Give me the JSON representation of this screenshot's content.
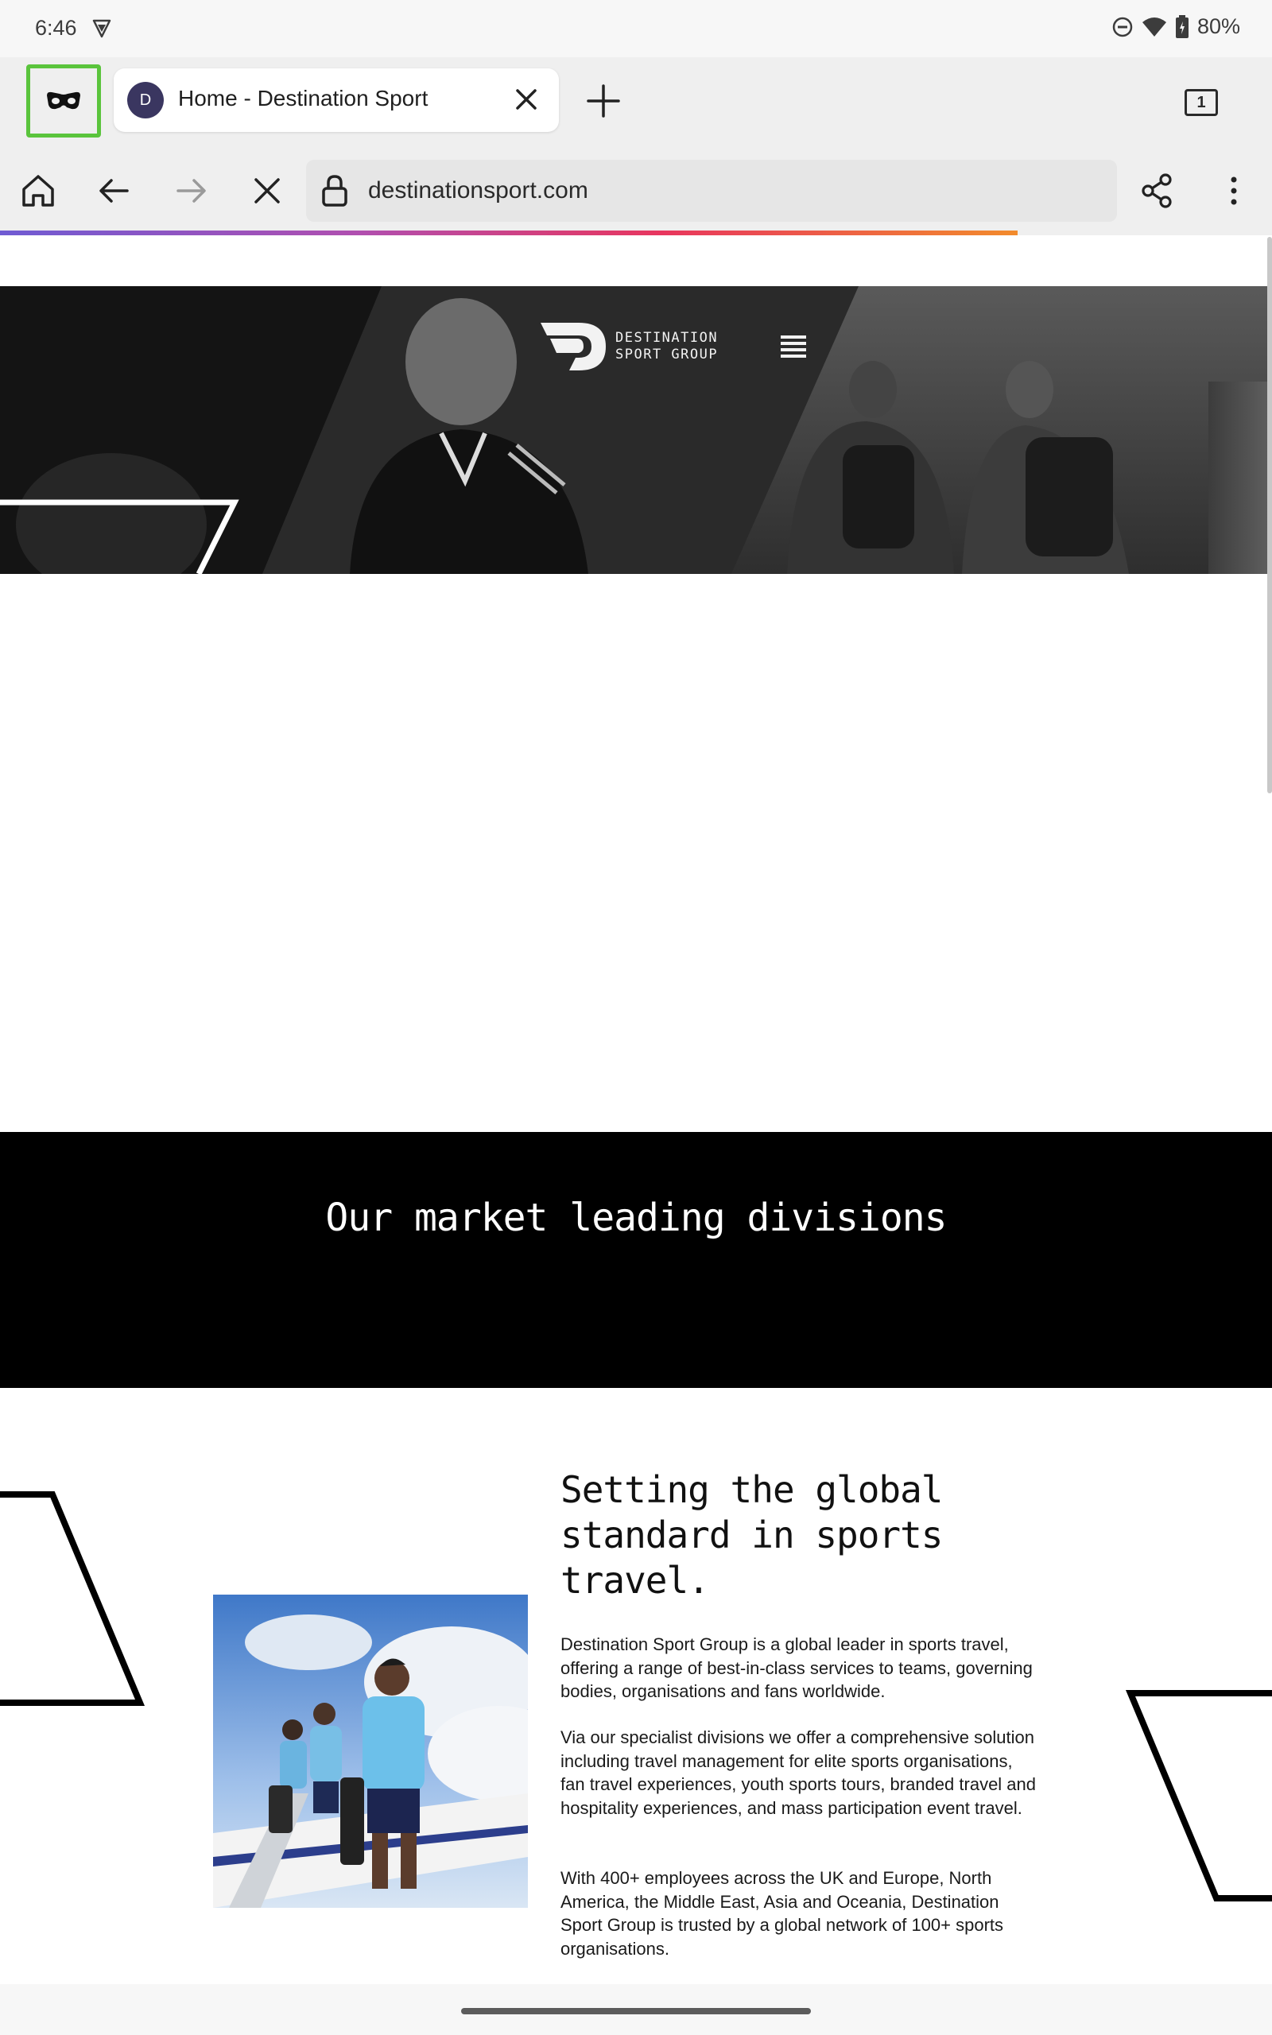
{
  "status_bar": {
    "time": "6:46",
    "battery": "80%"
  },
  "tab_strip": {
    "tab": {
      "favicon_letter": "D",
      "title": "Home - Destination Sport"
    },
    "tab_count": "1"
  },
  "toolbar": {
    "url": "destinationsport.com",
    "page_loading": true
  },
  "site": {
    "logo_line1": "DESTINATION",
    "logo_line2": "SPORT GROUP",
    "divisions_heading": "Our market leading divisions",
    "about_heading": "Setting the global standard in sports travel.",
    "about_paragraphs": [
      "Destination Sport Group is a global leader in sports travel, offering a range of best-in-class services to teams, governing bodies, organisations and fans worldwide.",
      "Via our specialist divisions we offer a comprehensive solution including travel management for elite sports organisations, fan travel experiences, youth sports tours, branded travel and hospitality experiences, and mass participation event travel.",
      "With 400+ employees across the UK and Europe, North America, the Middle East, Asia and Oceania, Destination Sport Group is trusted by a global network of 100+ sports organisations."
    ]
  },
  "icons": {
    "status": [
      "vpn-icon",
      "dnd-icon",
      "wifi-icon",
      "battery-icon"
    ],
    "tab_strip": [
      "incognito-icon",
      "tab-close-icon",
      "new-tab-icon",
      "tab-switcher-icon"
    ],
    "toolbar": [
      "home-icon",
      "back-icon",
      "forward-icon",
      "stop-icon",
      "lock-icon",
      "share-icon",
      "more-menu-icon"
    ],
    "site": [
      "hamburger-menu-icon"
    ]
  },
  "colors": {
    "incognito_highlight": "#5ac43c",
    "favicon_bg": "#3a3660",
    "progress_start": "#6f5bd3",
    "progress_end": "#f28b2c",
    "divisions_bg": "#000000"
  }
}
